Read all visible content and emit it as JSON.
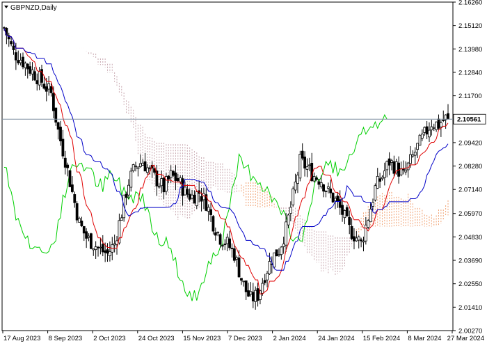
{
  "header": {
    "symbol_title": "GBPNZD,Daily",
    "menu_icon": "triangle-down-icon"
  },
  "colors": {
    "background": "#ffffff",
    "candle": "#000000",
    "tenkan": "#e00000",
    "kijun": "#0000c8",
    "chikou": "#00d000",
    "kumo_bull": "#f0a070",
    "kumo_bear": "#c8a8b0",
    "current_price_line": "#7f8fa0"
  },
  "chart_data": {
    "type": "candlestick",
    "indicator": "Ichimoku Kinko Hyo",
    "symbol": "GBPNZD",
    "timeframe": "Daily",
    "current_price": "2.10561",
    "ylim": [
      2.0027,
      2.1626
    ],
    "y_ticks": [
      "2.16260",
      "2.15120",
      "2.13980",
      "2.12840",
      "2.11700",
      "2.10561",
      "2.09420",
      "2.08280",
      "2.07140",
      "2.05970",
      "2.04830",
      "2.03690",
      "2.02550",
      "2.01410",
      "2.00270"
    ],
    "x_ticks": [
      "17 Aug 2023",
      "8 Sep 2023",
      "2 Oct 2023",
      "24 Oct 2023",
      "15 Nov 2023",
      "7 Dec 2023",
      "2 Jan 2024",
      "24 Jan 2024",
      "15 Feb 2024",
      "8 Mar 2024",
      "27 Mar 2024"
    ],
    "anchors": [
      [
        0,
        2.15
      ],
      [
        4,
        2.138
      ],
      [
        7,
        2.135
      ],
      [
        11,
        2.13
      ],
      [
        16,
        2.124
      ],
      [
        20,
        2.118
      ],
      [
        23,
        2.1
      ],
      [
        26,
        2.086
      ],
      [
        29,
        2.07
      ],
      [
        32,
        2.055
      ],
      [
        35,
        2.048
      ],
      [
        38,
        2.045
      ],
      [
        41,
        2.042
      ],
      [
        44,
        2.04
      ],
      [
        47,
        2.045
      ],
      [
        50,
        2.06
      ],
      [
        53,
        2.075
      ],
      [
        56,
        2.083
      ],
      [
        59,
        2.085
      ],
      [
        62,
        2.08
      ],
      [
        65,
        2.076
      ],
      [
        68,
        2.072
      ],
      [
        71,
        2.078
      ],
      [
        74,
        2.076
      ],
      [
        77,
        2.07
      ],
      [
        80,
        2.068
      ],
      [
        83,
        2.07
      ],
      [
        86,
        2.065
      ],
      [
        89,
        2.055
      ],
      [
        92,
        2.048
      ],
      [
        95,
        2.045
      ],
      [
        98,
        2.04
      ],
      [
        101,
        2.028
      ],
      [
        103,
        2.022
      ],
      [
        105,
        2.018
      ],
      [
        108,
        2.02
      ],
      [
        111,
        2.03
      ],
      [
        114,
        2.038
      ],
      [
        117,
        2.042
      ],
      [
        120,
        2.052
      ],
      [
        123,
        2.068
      ],
      [
        126,
        2.085
      ],
      [
        129,
        2.082
      ],
      [
        132,
        2.078
      ],
      [
        135,
        2.076
      ],
      [
        138,
        2.07
      ],
      [
        141,
        2.066
      ],
      [
        144,
        2.06
      ],
      [
        147,
        2.052
      ],
      [
        150,
        2.048
      ],
      [
        152,
        2.045
      ],
      [
        155,
        2.058
      ],
      [
        158,
        2.072
      ],
      [
        161,
        2.078
      ],
      [
        164,
        2.085
      ],
      [
        167,
        2.082
      ],
      [
        170,
        2.078
      ],
      [
        173,
        2.085
      ],
      [
        176,
        2.092
      ],
      [
        179,
        2.098
      ],
      [
        182,
        2.104
      ],
      [
        185,
        2.103
      ],
      [
        188,
        2.106
      ]
    ],
    "seed": 7,
    "n_bars": 190,
    "cloud_shift": 26,
    "tenkan_period": 9,
    "kijun_period": 26,
    "senkou_b_period": 52
  }
}
